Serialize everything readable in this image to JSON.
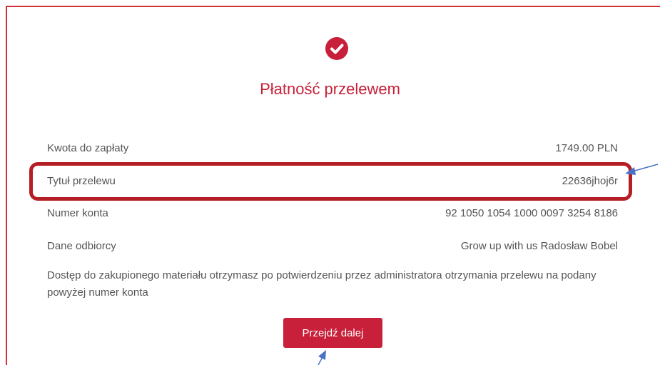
{
  "header": {
    "icon": "check-circle-icon",
    "title": "Płatność przelewem"
  },
  "details": [
    {
      "label": "Kwota do zapłaty",
      "value": "1749.00 PLN"
    },
    {
      "label": "Tytuł przelewu",
      "value": "22636jhoj6r"
    },
    {
      "label": "Numer konta",
      "value": "92 1050 1054 1000 0097 3254 8186"
    },
    {
      "label": "Dane odbiorcy",
      "value": "Grow up with us Radosław Bobel"
    }
  ],
  "note": "Dostęp do zakupionego materiału otrzymasz po potwierdzeniu przez administratora otrzymania przelewu na podany powyżej numer konta",
  "actions": {
    "continue_label": "Przejdź dalej"
  },
  "colors": {
    "accent": "#c8203a",
    "highlight_border": "#b51e24",
    "annotation_arrow": "#4a72c4"
  }
}
